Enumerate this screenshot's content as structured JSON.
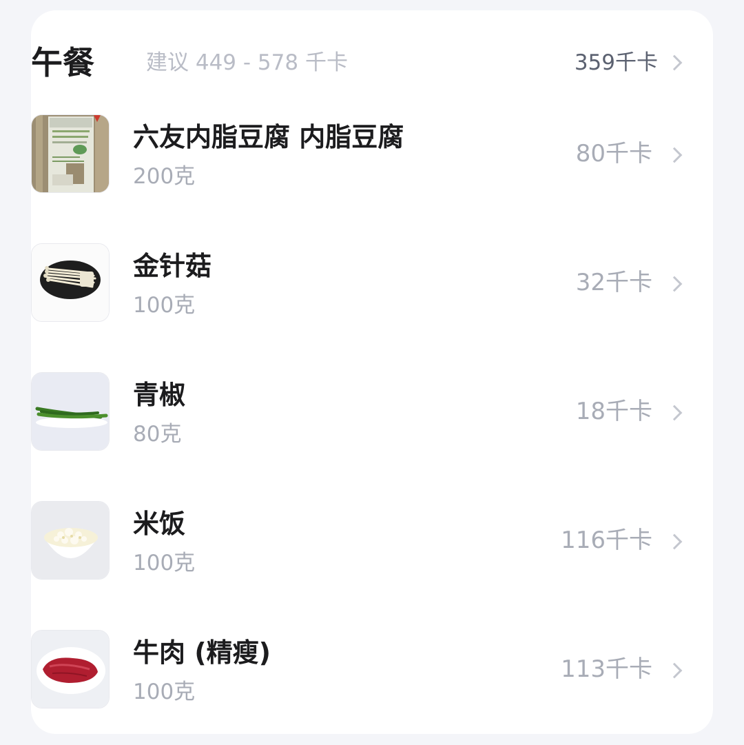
{
  "meal": {
    "title": "午餐",
    "suggestion": "建议 449 - 578 千卡",
    "total": "359千卡"
  },
  "items": [
    {
      "name": "六友内脂豆腐 内脂豆腐",
      "amount": "200克",
      "kcal": "80千卡",
      "icon": "tofu-package-photo"
    },
    {
      "name": "金针菇",
      "amount": "100克",
      "kcal": "32千卡",
      "icon": "enoki-mushroom-photo"
    },
    {
      "name": "青椒",
      "amount": "80克",
      "kcal": "18千卡",
      "icon": "green-pepper-photo"
    },
    {
      "name": "米饭",
      "amount": "100克",
      "kcal": "116千卡",
      "icon": "rice-bowl-photo"
    },
    {
      "name": "牛肉 (精瘦)",
      "amount": "100克",
      "kcal": "113千卡",
      "icon": "beef-photo"
    }
  ]
}
